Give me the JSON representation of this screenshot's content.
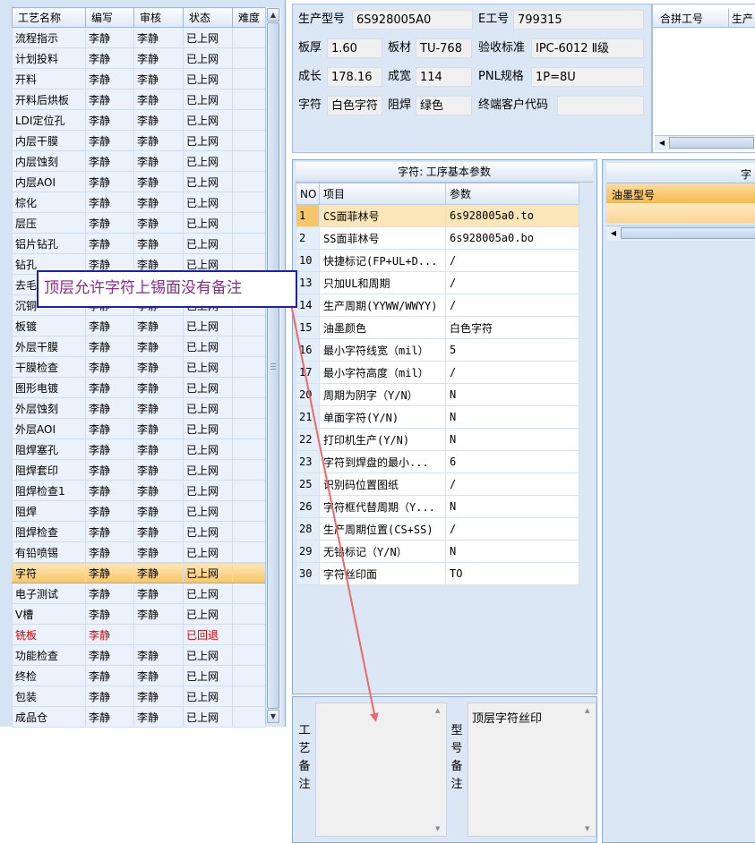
{
  "process_table": {
    "columns": [
      "工艺名称",
      "编写",
      "审核",
      "状态",
      "难度"
    ],
    "rows": [
      [
        "流程指示",
        "李静",
        "李静",
        "已上网",
        ""
      ],
      [
        "计划投料",
        "李静",
        "李静",
        "已上网",
        ""
      ],
      [
        "开料",
        "李静",
        "李静",
        "已上网",
        ""
      ],
      [
        "开料后烘板",
        "李静",
        "李静",
        "已上网",
        ""
      ],
      [
        "LDI定位孔",
        "李静",
        "李静",
        "已上网",
        ""
      ],
      [
        "内层干膜",
        "李静",
        "李静",
        "已上网",
        ""
      ],
      [
        "内层蚀刻",
        "李静",
        "李静",
        "已上网",
        ""
      ],
      [
        "内层AOI",
        "李静",
        "李静",
        "已上网",
        ""
      ],
      [
        "棕化",
        "李静",
        "李静",
        "已上网",
        ""
      ],
      [
        "层压",
        "李静",
        "李静",
        "已上网",
        ""
      ],
      [
        "铝片钻孔",
        "李静",
        "李静",
        "已上网",
        ""
      ],
      [
        "钻孔",
        "李静",
        "李静",
        "已上网",
        ""
      ],
      [
        "去毛",
        "李静",
        "李静",
        "已上网",
        ""
      ],
      [
        "沉铜",
        "李静",
        "李静",
        "已上网",
        ""
      ],
      [
        "板镀",
        "李静",
        "李静",
        "已上网",
        ""
      ],
      [
        "外层干膜",
        "李静",
        "李静",
        "已上网",
        ""
      ],
      [
        "干膜检查",
        "李静",
        "李静",
        "已上网",
        ""
      ],
      [
        "图形电镀",
        "李静",
        "李静",
        "已上网",
        ""
      ],
      [
        "外层蚀刻",
        "李静",
        "李静",
        "已上网",
        ""
      ],
      [
        "外层AOI",
        "李静",
        "李静",
        "已上网",
        ""
      ],
      [
        "阻焊塞孔",
        "李静",
        "李静",
        "已上网",
        ""
      ],
      [
        "阻焊套印",
        "李静",
        "李静",
        "已上网",
        ""
      ],
      [
        "阻焊检查1",
        "李静",
        "李静",
        "已上网",
        ""
      ],
      [
        "阻焊",
        "李静",
        "李静",
        "已上网",
        ""
      ],
      [
        "阻焊检查",
        "李静",
        "李静",
        "已上网",
        ""
      ],
      [
        "有铅喷锡",
        "李静",
        "李静",
        "已上网",
        ""
      ],
      [
        "字符",
        "李静",
        "李静",
        "已上网",
        ""
      ],
      [
        "电子测试",
        "李静",
        "李静",
        "已上网",
        ""
      ],
      [
        "V槽",
        "李静",
        "李静",
        "已上网",
        ""
      ],
      [
        "铣板",
        "李静",
        "",
        "已回退",
        ""
      ],
      [
        "功能检查",
        "李静",
        "李静",
        "已上网",
        ""
      ],
      [
        "终检",
        "李静",
        "李静",
        "已上网",
        ""
      ],
      [
        "包装",
        "李静",
        "李静",
        "已上网",
        ""
      ],
      [
        "成品仓",
        "李静",
        "李静",
        "已上网",
        ""
      ]
    ],
    "selected_row": 26,
    "red_row": 29
  },
  "info": {
    "model_label": "生产型号",
    "model_value": "6S928005A0",
    "e_label": "E工号",
    "e_value": "799315",
    "thick_label": "板厚",
    "thick_value": "1.60",
    "mat_label": "板材",
    "mat_value": "TU-768",
    "std_label": "验收标准",
    "std_value": "IPC-6012 Ⅱ级",
    "len_label": "成长",
    "len_value": "178.16",
    "wid_label": "成宽",
    "wid_value": "114",
    "pnl_label": "PNL规格",
    "pnl_value": "1P=8U",
    "char_label": "字符",
    "char_value": "白色字符",
    "mask_label": "阻焊",
    "mask_value": "绿色",
    "cust_label": "终端客户代码",
    "cust_value": ""
  },
  "merge": {
    "col1": "合拼工号",
    "col2": "生产"
  },
  "params": {
    "title": "字符: 工序基本参数",
    "col_no": "NO",
    "col_item": "项目",
    "col_value": "参数",
    "rows": [
      [
        "1",
        "CS面菲林号",
        "6s928005a0.to"
      ],
      [
        "2",
        "SS面菲林号",
        "6s928005a0.bo"
      ],
      [
        "10",
        "快捷标记(FP+UL+D...",
        "/"
      ],
      [
        "13",
        "只加UL和周期",
        "/"
      ],
      [
        "14",
        "生产周期(YYWW/WWYY)",
        "/"
      ],
      [
        "15",
        "油墨颜色",
        "白色字符"
      ],
      [
        "16",
        "最小字符线宽（mil）",
        "5"
      ],
      [
        "17",
        "最小字符高度（mil）",
        "/"
      ],
      [
        "20",
        "周期为阴字（Y/N）",
        "N"
      ],
      [
        "21",
        "单面字符(Y/N)",
        "N"
      ],
      [
        "22",
        "打印机生产(Y/N)",
        "N"
      ],
      [
        "23",
        "字符到焊盘的最小...",
        "6"
      ],
      [
        "25",
        "识别码位置图纸",
        "/"
      ],
      [
        "26",
        "字符框代替周期（Y...",
        "N"
      ],
      [
        "28",
        "生产周期位置(CS+SS)",
        "/"
      ],
      [
        "29",
        "无铅标记（Y/N）",
        "N"
      ],
      [
        "30",
        "字符丝印面",
        "TO"
      ]
    ]
  },
  "ink": {
    "title": "字符",
    "col": "油墨型号"
  },
  "remarks": {
    "process_label": "工艺备注",
    "process_text": "",
    "model_label": "型号备注",
    "model_text": "顶层字符丝印"
  },
  "annotation": {
    "text": "顶层允许字符上锡面没有备注",
    "arrow_color": "#e86a6a",
    "box_color": "#1e1eb4"
  }
}
